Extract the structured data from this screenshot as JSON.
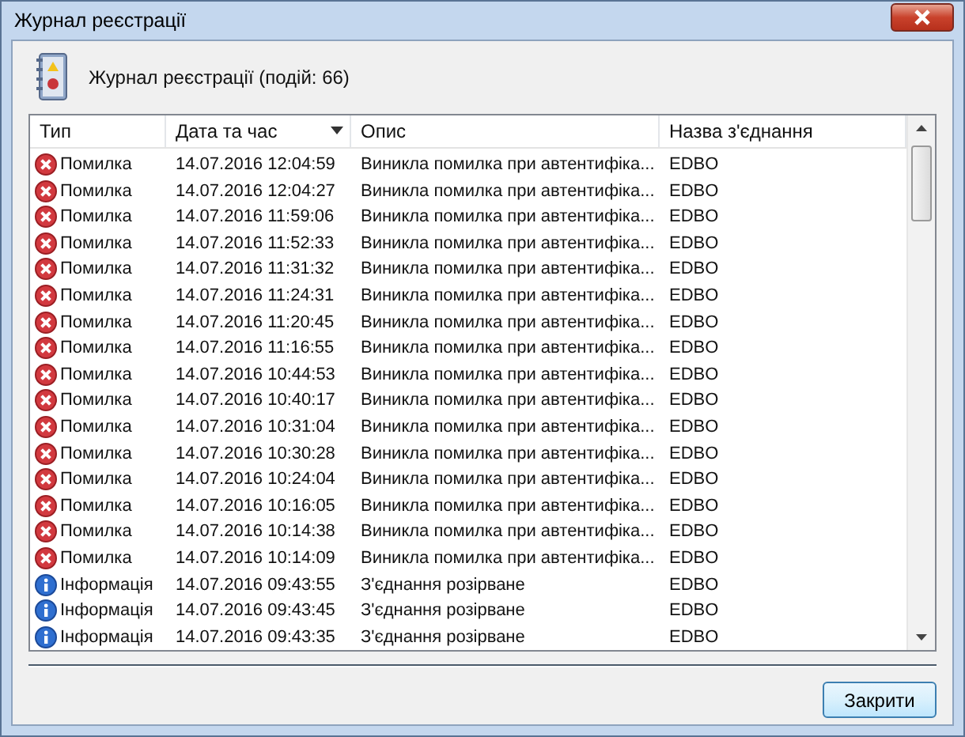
{
  "window": {
    "title": "Журнал реєстрації"
  },
  "header": {
    "text": "Журнал реєстрації (подій: 66)"
  },
  "table": {
    "columns": [
      {
        "label": "Тип",
        "sorted": false
      },
      {
        "label": "Дата та час",
        "sorted": true
      },
      {
        "label": "Опис",
        "sorted": false
      },
      {
        "label": "Назва з'єднання",
        "sorted": false
      }
    ],
    "rows": [
      {
        "kind": "error",
        "type": "Помилка",
        "datetime": "14.07.2016 12:04:59",
        "description": "Виникла помилка при автентифіка...",
        "connection": "EDBO"
      },
      {
        "kind": "error",
        "type": "Помилка",
        "datetime": "14.07.2016 12:04:27",
        "description": "Виникла помилка при автентифіка...",
        "connection": "EDBO"
      },
      {
        "kind": "error",
        "type": "Помилка",
        "datetime": "14.07.2016 11:59:06",
        "description": "Виникла помилка при автентифіка...",
        "connection": "EDBO"
      },
      {
        "kind": "error",
        "type": "Помилка",
        "datetime": "14.07.2016 11:52:33",
        "description": "Виникла помилка при автентифіка...",
        "connection": "EDBO"
      },
      {
        "kind": "error",
        "type": "Помилка",
        "datetime": "14.07.2016 11:31:32",
        "description": "Виникла помилка при автентифіка...",
        "connection": "EDBO"
      },
      {
        "kind": "error",
        "type": "Помилка",
        "datetime": "14.07.2016 11:24:31",
        "description": "Виникла помилка при автентифіка...",
        "connection": "EDBO"
      },
      {
        "kind": "error",
        "type": "Помилка",
        "datetime": "14.07.2016 11:20:45",
        "description": "Виникла помилка при автентифіка...",
        "connection": "EDBO"
      },
      {
        "kind": "error",
        "type": "Помилка",
        "datetime": "14.07.2016 11:16:55",
        "description": "Виникла помилка при автентифіка...",
        "connection": "EDBO"
      },
      {
        "kind": "error",
        "type": "Помилка",
        "datetime": "14.07.2016 10:44:53",
        "description": "Виникла помилка при автентифіка...",
        "connection": "EDBO"
      },
      {
        "kind": "error",
        "type": "Помилка",
        "datetime": "14.07.2016 10:40:17",
        "description": "Виникла помилка при автентифіка...",
        "connection": "EDBO"
      },
      {
        "kind": "error",
        "type": "Помилка",
        "datetime": "14.07.2016 10:31:04",
        "description": "Виникла помилка при автентифіка...",
        "connection": "EDBO"
      },
      {
        "kind": "error",
        "type": "Помилка",
        "datetime": "14.07.2016 10:30:28",
        "description": "Виникла помилка при автентифіка...",
        "connection": "EDBO"
      },
      {
        "kind": "error",
        "type": "Помилка",
        "datetime": "14.07.2016 10:24:04",
        "description": "Виникла помилка при автентифіка...",
        "connection": "EDBO"
      },
      {
        "kind": "error",
        "type": "Помилка",
        "datetime": "14.07.2016 10:16:05",
        "description": "Виникла помилка при автентифіка...",
        "connection": "EDBO"
      },
      {
        "kind": "error",
        "type": "Помилка",
        "datetime": "14.07.2016 10:14:38",
        "description": "Виникла помилка при автентифіка...",
        "connection": "EDBO"
      },
      {
        "kind": "error",
        "type": "Помилка",
        "datetime": "14.07.2016 10:14:09",
        "description": "Виникла помилка при автентифіка...",
        "connection": "EDBO"
      },
      {
        "kind": "info",
        "type": "Інформація",
        "datetime": "14.07.2016 09:43:55",
        "description": "З'єднання розірване",
        "connection": "EDBO"
      },
      {
        "kind": "info",
        "type": "Інформація",
        "datetime": "14.07.2016 09:43:45",
        "description": "З'єднання розірване",
        "connection": "EDBO"
      },
      {
        "kind": "info",
        "type": "Інформація",
        "datetime": "14.07.2016 09:43:35",
        "description": "З'єднання розірване",
        "connection": "EDBO"
      }
    ]
  },
  "buttons": [
    {
      "label": "Закрити"
    }
  ]
}
